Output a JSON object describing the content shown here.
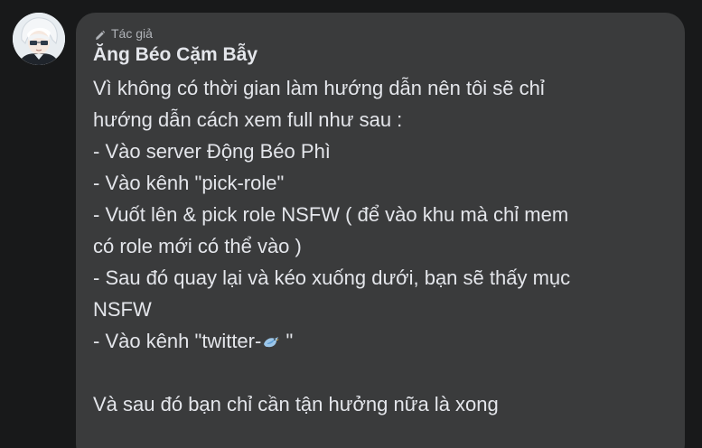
{
  "post": {
    "author_tag": "Tác giả",
    "author_name": "Ăng Béo Cặm Bẫy",
    "lines": [
      "Vì không có thời gian làm hướng dẫn nên tôi sẽ chỉ",
      "hướng dẫn cách xem full như sau :",
      "- Vào server Động Béo Phì",
      "- Vào kênh \"pick-role\"",
      "- Vuốt lên & pick role NSFW ( để vào khu mà chỉ mem",
      "có role mới có thể vào )",
      "- Sau đó quay lại và kéo xuống dưới, bạn sẽ thấy mục",
      "NSFW",
      "- Vào kênh \"twitter-",
      "\"",
      "",
      "Và sau đó bạn chỉ cần tận hưởng nữa là xong"
    ]
  },
  "icons": {
    "author_tag_icon": "pencil-icon",
    "channel_emoji": "bird-emoji",
    "avatar": "anime-character-avatar"
  },
  "colors": {
    "background": "#18191a",
    "bubble": "#3a3b3c",
    "text": "#e4e6eb",
    "muted": "#b0b3b8"
  }
}
